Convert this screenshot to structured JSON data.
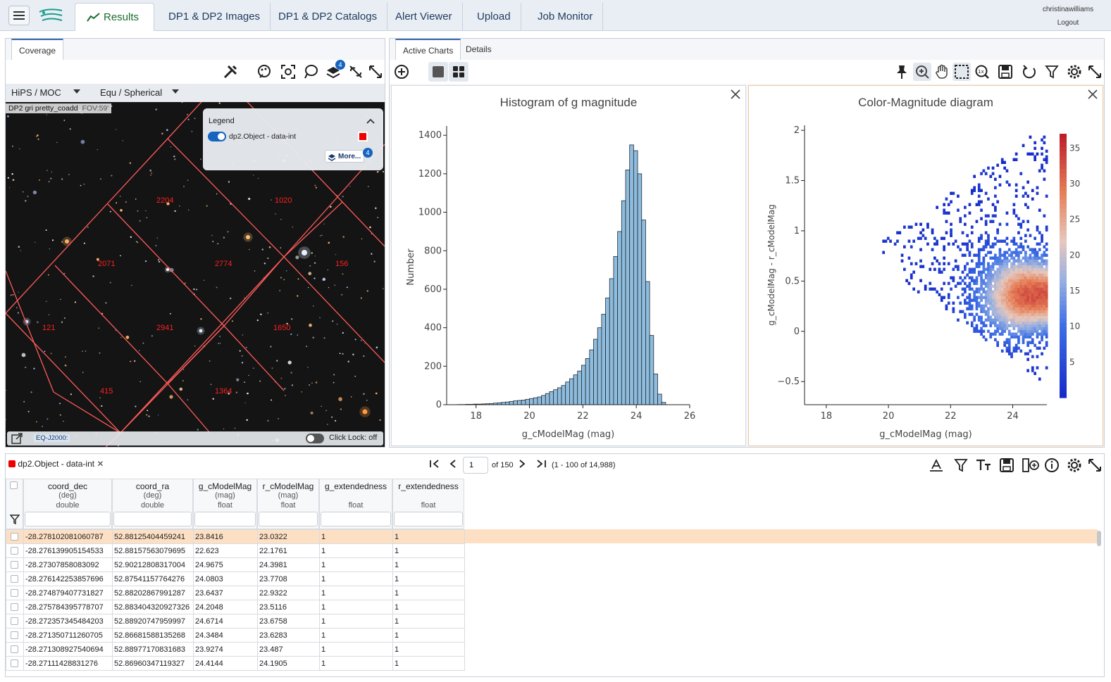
{
  "nav": {
    "tabs": [
      {
        "label": "Results"
      },
      {
        "label": "DP1 & DP2 Images"
      },
      {
        "label": "DP1 & DP2 Catalogs"
      },
      {
        "label": "Alert Viewer"
      },
      {
        "label": "Upload"
      },
      {
        "label": "Job Monitor"
      }
    ],
    "user": "christinawilliams",
    "logout": "Logout"
  },
  "coverage": {
    "tab": "Coverage",
    "hips_select": "HiPS / MOC",
    "coord_select": "Equ / Spherical",
    "image_title": "DP2 gri pretty_coadd",
    "fov": "FOV:59'",
    "layers_badge": "4",
    "legend": {
      "title": "Legend",
      "layer": "dp2.Object - data-int",
      "more": "More...",
      "badge": "4"
    },
    "tiles": [
      "2204",
      "1020",
      "2071",
      "2774",
      "156",
      "121",
      "2941",
      "1650",
      "415",
      "1364"
    ],
    "coord_sys": "EQ-J2000:",
    "click_lock": "Click Lock: off"
  },
  "charts": {
    "tabs": [
      "Active Charts",
      "Details"
    ]
  },
  "chart_data": [
    {
      "type": "bar",
      "title": "Histogram of g magnitude",
      "xlabel": "g_cModelMag (mag)",
      "ylabel": "Number",
      "xlim": [
        16.9,
        26
      ],
      "ylim": [
        0,
        1430
      ],
      "xticks": [
        "18",
        "20",
        "22",
        "24",
        "26"
      ],
      "yticks": [
        "0",
        "200",
        "400",
        "600",
        "800",
        "1000",
        "1200",
        "1400"
      ],
      "bin_start": 17.3,
      "bin_width": 0.15,
      "values": [
        1,
        1,
        2,
        2,
        3,
        3,
        4,
        5,
        6,
        8,
        10,
        12,
        14,
        17,
        20,
        22,
        24,
        28,
        32,
        36,
        40,
        48,
        58,
        68,
        78,
        88,
        100,
        118,
        135,
        155,
        175,
        205,
        240,
        285,
        340,
        400,
        470,
        555,
        655,
        770,
        900,
        1060,
        1220,
        1350,
        1320,
        1200,
        960,
        640,
        360,
        160,
        55,
        12
      ]
    },
    {
      "type": "heatmap",
      "title": "Color-Magnitude diagram",
      "xlabel": "g_cModelMag (mag)",
      "ylabel": "g_cModelMag - r_cModelMag",
      "xlim": [
        17.3,
        25.1
      ],
      "ylim": [
        -0.73,
        2.05
      ],
      "xticks": [
        "18",
        "20",
        "22",
        "24"
      ],
      "yticks": [
        "−0.5",
        "0",
        "0.5",
        "1",
        "1.5",
        "2"
      ],
      "colorbar": {
        "min": 0,
        "max": 37,
        "ticks": [
          "5",
          "10",
          "15",
          "20",
          "25",
          "30",
          "35"
        ]
      },
      "peak": {
        "x": 24.4,
        "y": 0.3
      }
    }
  ],
  "table": {
    "title": "dp2.Object - data-int",
    "page": "1",
    "of": "of 150",
    "range": "(1 - 100 of 14,988)",
    "columns": [
      {
        "name": "coord_dec",
        "unit": "(deg)",
        "type": "double"
      },
      {
        "name": "coord_ra",
        "unit": "(deg)",
        "type": "double"
      },
      {
        "name": "g_cModelMag",
        "unit": "(mag)",
        "type": "float"
      },
      {
        "name": "r_cModelMag",
        "unit": "(mag)",
        "type": "float"
      },
      {
        "name": "g_extendedness",
        "unit": "",
        "type": "float"
      },
      {
        "name": "r_extendedness",
        "unit": "",
        "type": "float"
      }
    ],
    "rows": [
      [
        "-28.278102081060787",
        "52.88125404459241",
        "23.8416",
        "23.0322",
        "1",
        "1"
      ],
      [
        "-28.276139905154533",
        "52.88157563079695",
        "22.623",
        "22.1761",
        "1",
        "1"
      ],
      [
        "-28.27307858083092",
        "52.90212808317004",
        "24.9675",
        "24.3981",
        "1",
        "1"
      ],
      [
        "-28.276142253857696",
        "52.87541157764276",
        "24.0803",
        "23.7708",
        "1",
        "1"
      ],
      [
        "-28.274879407731827",
        "52.88202867991287",
        "23.6437",
        "22.9322",
        "1",
        "1"
      ],
      [
        "-28.275784395778707",
        "52.883404320927326",
        "24.2048",
        "23.5116",
        "1",
        "1"
      ],
      [
        "-28.272357345484203",
        "52.88920747959997",
        "24.6714",
        "23.6758",
        "1",
        "1"
      ],
      [
        "-28.271350711260705",
        "52.86681588135268",
        "24.3484",
        "23.6283",
        "1",
        "1"
      ],
      [
        "-28.271308927540694",
        "52.88977170831683",
        "23.9274",
        "23.487",
        "1",
        "1"
      ],
      [
        "-28.27111428831276",
        "52.86960347119327",
        "24.4144",
        "24.1905",
        "1",
        "1"
      ]
    ]
  }
}
